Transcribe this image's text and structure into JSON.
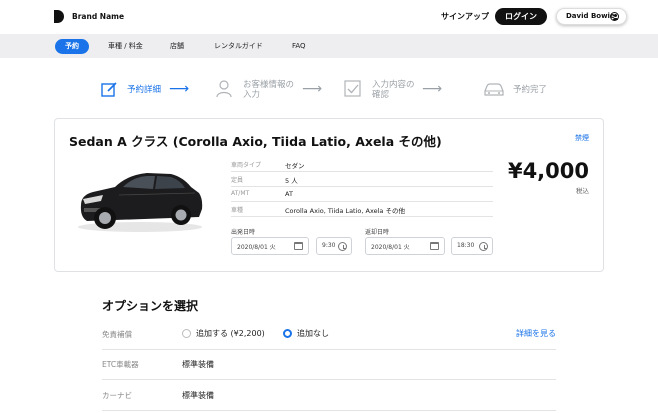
{
  "header": {
    "brand": "Brand Name",
    "signup": "サインアップ",
    "login": "ログイン",
    "user_name": "David Bowie"
  },
  "nav": {
    "items": [
      {
        "label": "予約",
        "active": true
      },
      {
        "label": "車種 / 料金"
      },
      {
        "label": "店舗"
      },
      {
        "label": "レンタルガイド"
      },
      {
        "label": "FAQ"
      }
    ]
  },
  "steps": [
    {
      "label": "予約詳細",
      "icon": "edit-icon",
      "status": "active"
    },
    {
      "label_line1": "お客様情報の",
      "label_line2": "入力",
      "icon": "person-icon",
      "status": "inactive"
    },
    {
      "label_line1": "入力内容の",
      "label_line2": "確認",
      "icon": "checkbox-icon",
      "status": "inactive"
    },
    {
      "label": "予約完了",
      "icon": "car-icon",
      "status": "inactive"
    }
  ],
  "car": {
    "title": "Sedan A クラス (Corolla Axio, Tiida Latio, Axela その他)",
    "forbid_link": "禁煙",
    "specs": [
      {
        "label": "車両タイプ",
        "value": "セダン"
      },
      {
        "label": "定員",
        "value": "5 人"
      },
      {
        "label": "AT/MT",
        "value": "AT"
      },
      {
        "label": "車種",
        "value": "Corolla Axio, Tiida Latio, Axela その他"
      }
    ],
    "price": "¥4,000",
    "tax_note": "税込",
    "departure_label": "出発日時",
    "departure_date": "2020/8/01 火",
    "departure_time": "9:30",
    "return_label": "返却日時",
    "return_date": "2020/8/01 火",
    "return_time": "18:30"
  },
  "options": {
    "title": "オプションを選択",
    "insurance_label": "免責補償",
    "insurance_add": "追加する (¥2,200)",
    "insurance_none": "追加なし",
    "insurance_selected": "none",
    "details_link": "詳細を見る",
    "etc_label": "ETC車載器",
    "etc_value": "標準装備",
    "navi_label": "カーナビ",
    "navi_value": "標準装備"
  },
  "colors": {
    "accent": "#1a73e8",
    "dark": "#111111",
    "nav_bg": "#eeeef1"
  }
}
